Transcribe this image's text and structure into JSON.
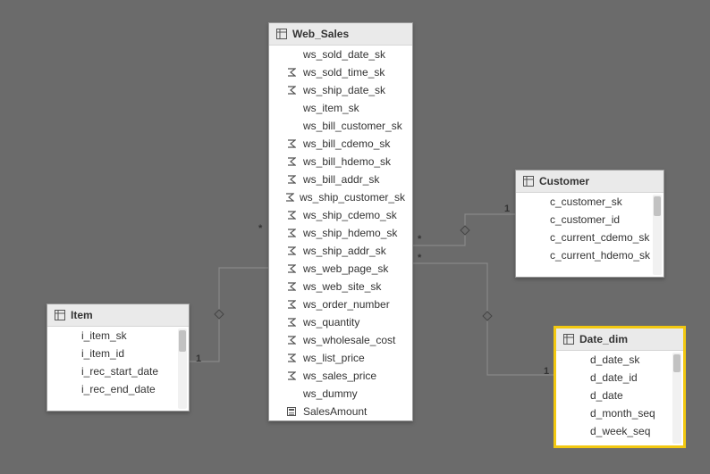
{
  "tables": {
    "item": {
      "title": "Item",
      "fields": [
        {
          "name": "i_item_sk",
          "icon": "none"
        },
        {
          "name": "i_item_id",
          "icon": "none"
        },
        {
          "name": "i_rec_start_date",
          "icon": "none"
        },
        {
          "name": "i_rec_end_date",
          "icon": "none"
        }
      ]
    },
    "web_sales": {
      "title": "Web_Sales",
      "fields": [
        {
          "name": "ws_sold_date_sk",
          "icon": "none"
        },
        {
          "name": "ws_sold_time_sk",
          "icon": "sigma"
        },
        {
          "name": "ws_ship_date_sk",
          "icon": "sigma"
        },
        {
          "name": "ws_item_sk",
          "icon": "none"
        },
        {
          "name": "ws_bill_customer_sk",
          "icon": "none"
        },
        {
          "name": "ws_bill_cdemo_sk",
          "icon": "sigma"
        },
        {
          "name": "ws_bill_hdemo_sk",
          "icon": "sigma"
        },
        {
          "name": "ws_bill_addr_sk",
          "icon": "sigma"
        },
        {
          "name": "ws_ship_customer_sk",
          "icon": "sigma"
        },
        {
          "name": "ws_ship_cdemo_sk",
          "icon": "sigma"
        },
        {
          "name": "ws_ship_hdemo_sk",
          "icon": "sigma"
        },
        {
          "name": "ws_ship_addr_sk",
          "icon": "sigma"
        },
        {
          "name": "ws_web_page_sk",
          "icon": "sigma"
        },
        {
          "name": "ws_web_site_sk",
          "icon": "sigma"
        },
        {
          "name": "ws_order_number",
          "icon": "sigma"
        },
        {
          "name": "ws_quantity",
          "icon": "sigma"
        },
        {
          "name": "ws_wholesale_cost",
          "icon": "sigma"
        },
        {
          "name": "ws_list_price",
          "icon": "sigma"
        },
        {
          "name": "ws_sales_price",
          "icon": "sigma"
        },
        {
          "name": "ws_dummy",
          "icon": "none"
        },
        {
          "name": "SalesAmount",
          "icon": "calc"
        }
      ]
    },
    "customer": {
      "title": "Customer",
      "fields": [
        {
          "name": "c_customer_sk",
          "icon": "none"
        },
        {
          "name": "c_customer_id",
          "icon": "none"
        },
        {
          "name": "c_current_cdemo_sk",
          "icon": "none"
        },
        {
          "name": "c_current_hdemo_sk",
          "icon": "none"
        }
      ]
    },
    "date_dim": {
      "title": "Date_dim",
      "fields": [
        {
          "name": "d_date_sk",
          "icon": "none"
        },
        {
          "name": "d_date_id",
          "icon": "none"
        },
        {
          "name": "d_date",
          "icon": "none"
        },
        {
          "name": "d_month_seq",
          "icon": "none"
        },
        {
          "name": "d_week_seq",
          "icon": "none"
        }
      ]
    }
  },
  "relationships": {
    "item_ws": {
      "left_card": "1",
      "right_card": "*"
    },
    "ws_customer": {
      "left_card": "*",
      "right_card": "1"
    },
    "ws_date": {
      "left_card": "*",
      "right_card": "1"
    }
  },
  "colors": {
    "selection": "#f2c811",
    "canvas_bg": "#6b6b6b"
  }
}
